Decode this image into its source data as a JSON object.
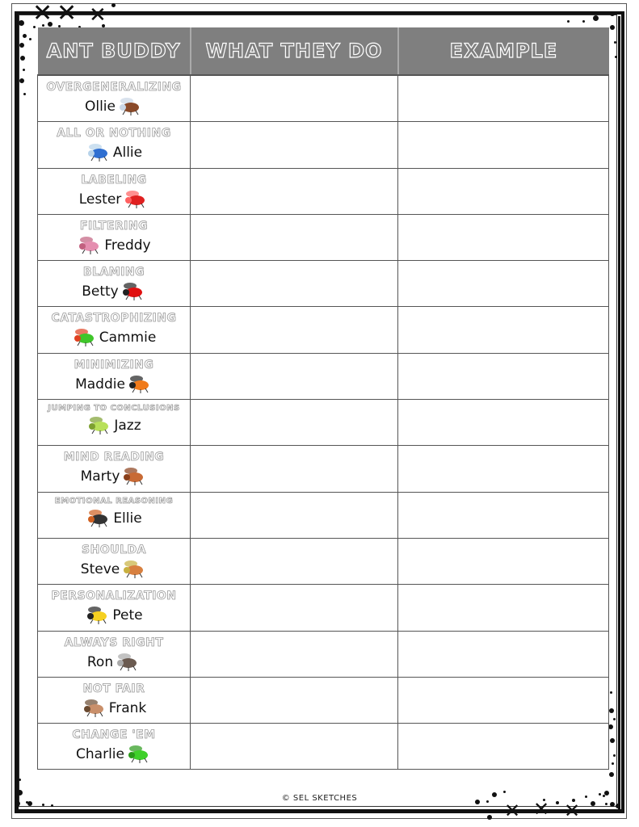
{
  "table": {
    "headers": [
      "ANT BUDDY",
      "WHAT THEY DO",
      "EXAMPLE"
    ],
    "rows": [
      {
        "skill": "OVERGENERALIZING",
        "name": "Ollie",
        "creature": "fly",
        "bug_side": "right",
        "what_they_do": "",
        "example": ""
      },
      {
        "skill": "ALL OR NOTHING",
        "name": "Allie",
        "creature": "dragonfly",
        "bug_side": "left",
        "what_they_do": "",
        "example": ""
      },
      {
        "skill": "LABELING",
        "name": "Lester",
        "creature": "scorpion",
        "bug_side": "right",
        "what_they_do": "",
        "example": ""
      },
      {
        "skill": "FILTERING",
        "name": "Freddy",
        "creature": "worm",
        "bug_side": "left",
        "what_they_do": "",
        "example": ""
      },
      {
        "skill": "BLAMING",
        "name": "Betty",
        "creature": "ladybug",
        "bug_side": "right",
        "what_they_do": "",
        "example": ""
      },
      {
        "skill": "CATASTROPHIZING",
        "name": "Cammie",
        "creature": "caterpillar",
        "bug_side": "left",
        "what_they_do": "",
        "example": ""
      },
      {
        "skill": "MINIMIZING",
        "name": "Maddie",
        "creature": "butterfly",
        "bug_side": "right",
        "what_they_do": "",
        "example": ""
      },
      {
        "skill": "JUMPING TO CONCLUSIONS",
        "name": "Jazz",
        "creature": "grasshopper",
        "bug_side": "left",
        "what_they_do": "",
        "example": ""
      },
      {
        "skill": "MIND READING",
        "name": "Marty",
        "creature": "cockroach",
        "bug_side": "right",
        "what_they_do": "",
        "example": ""
      },
      {
        "skill": "EMOTIONAL REASONING",
        "name": "Ellie",
        "creature": "spider",
        "bug_side": "left",
        "what_they_do": "",
        "example": ""
      },
      {
        "skill": "SHOULDA",
        "name": "Steve",
        "creature": "snail",
        "bug_side": "right",
        "what_they_do": "",
        "example": ""
      },
      {
        "skill": "PERSONALIZATION",
        "name": "Pete",
        "creature": "bee",
        "bug_side": "left",
        "what_they_do": "",
        "example": ""
      },
      {
        "skill": "ALWAYS RIGHT",
        "name": "Ron",
        "creature": "mosquito",
        "bug_side": "right",
        "what_they_do": "",
        "example": ""
      },
      {
        "skill": "NOT FAIR",
        "name": "Frank",
        "creature": "stick-insect",
        "bug_side": "left",
        "what_they_do": "",
        "example": ""
      },
      {
        "skill": "CHANGE 'EM",
        "name": "Charlie",
        "creature": "praying-mantis",
        "bug_side": "right",
        "what_they_do": "",
        "example": ""
      }
    ]
  },
  "footer": {
    "copyright": "© SEL SKETCHES"
  },
  "colors": {
    "header_bg": "#7f7f7f",
    "header_text_outline": "#ffffff",
    "skill_outline": "#9a9a9a",
    "grid_line": "#555555"
  }
}
